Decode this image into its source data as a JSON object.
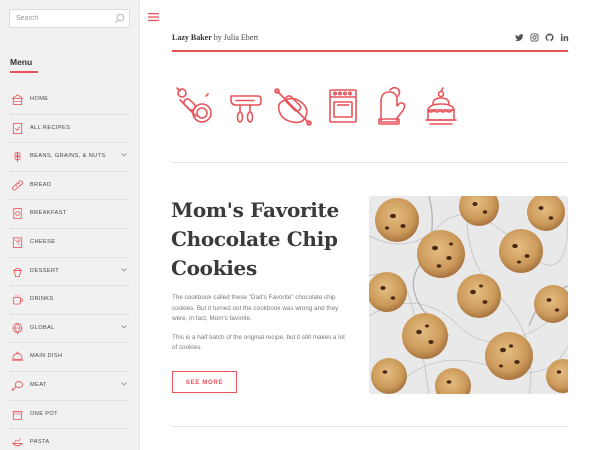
{
  "search": {
    "placeholder": "Search",
    "value": ""
  },
  "sidebar": {
    "menu_title": "Menu",
    "items": [
      {
        "label": "HOME",
        "icon": "house-icon",
        "has_submenu": false
      },
      {
        "label": "ALL RECIPES",
        "icon": "clipboard-check-icon",
        "has_submenu": false
      },
      {
        "label": "BEANS, GRAINS, & NUTS",
        "icon": "wheat-icon",
        "has_submenu": true
      },
      {
        "label": "BREAD",
        "icon": "baguette-icon",
        "has_submenu": false
      },
      {
        "label": "BREAKFAST",
        "icon": "cereal-box-icon",
        "has_submenu": false
      },
      {
        "label": "CHEESE",
        "icon": "cheese-icon",
        "has_submenu": false
      },
      {
        "label": "DESSERT",
        "icon": "cupcake-icon",
        "has_submenu": true
      },
      {
        "label": "DRINKS",
        "icon": "coffee-cup-icon",
        "has_submenu": false
      },
      {
        "label": "GLOBAL",
        "icon": "globe-icon",
        "has_submenu": true
      },
      {
        "label": "MAIN DISH",
        "icon": "cloche-icon",
        "has_submenu": false
      },
      {
        "label": "MEAT",
        "icon": "chicken-leg-icon",
        "has_submenu": true
      },
      {
        "label": "ONE POT",
        "icon": "pot-icon",
        "has_submenu": false
      },
      {
        "label": "PASTA",
        "icon": "pasta-icon",
        "has_submenu": false
      }
    ]
  },
  "header": {
    "site_name": "Lazy Baker",
    "byline": " by Julia Ebert",
    "social": [
      "twitter-icon",
      "instagram-icon",
      "github-icon",
      "linkedin-icon"
    ]
  },
  "category_icons": [
    "rolling-pin-plate-icon",
    "hand-mixer-icon",
    "rolling-pin-dough-icon",
    "oven-icon",
    "oven-mitt-icon",
    "cake-icon"
  ],
  "post": {
    "title": "Mom's Favorite Chocolate Chip Cookies",
    "excerpt_1": "The cookbook called these \"Dad's Favorite\" chocolate chip cookies. But it turned out the cookbook was wrong and they were, in fact, Mom's favorite.",
    "excerpt_2": "This is a half batch of the original recipe, but it still makes a lot of cookies.",
    "button_label": "SEE MORE",
    "image": "chocolate-chip-cookies-photo"
  },
  "colors": {
    "accent": "#e8535a",
    "sidebar_bg": "#f1f1f1",
    "text": "#444444"
  }
}
